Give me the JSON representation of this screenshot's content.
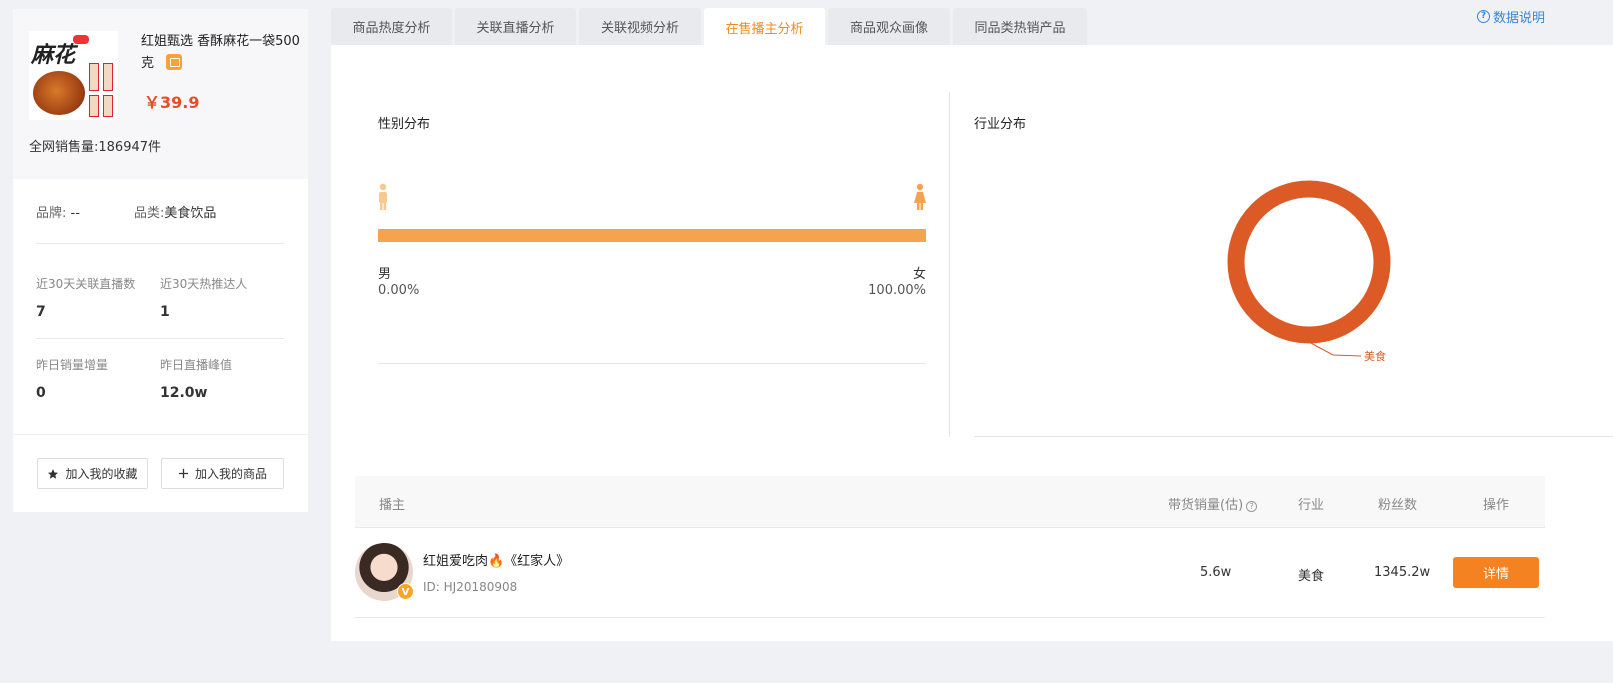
{
  "product": {
    "name": "红姐甄选 香酥麻花一袋500克",
    "image_text": "麻花",
    "price": "￥39.9",
    "sales_label": "全网销售量:",
    "sales_value": "186947件"
  },
  "meta": {
    "brand_label": "品牌:",
    "brand_value": "--",
    "category_label": "品类:",
    "category_value": "美食饮品"
  },
  "stats": [
    {
      "label": "近30天关联直播数",
      "value": "7"
    },
    {
      "label": "近30天热推达人",
      "value": "1"
    },
    {
      "label": "昨日销量增量",
      "value": "0"
    },
    {
      "label": "昨日直播峰值",
      "value": "12.0w"
    }
  ],
  "actions": {
    "add_favorite": "加入我的收藏",
    "add_product": "加入我的商品"
  },
  "tabs": [
    {
      "label": "商品热度分析"
    },
    {
      "label": "关联直播分析"
    },
    {
      "label": "关联视频分析"
    },
    {
      "label": "在售播主分析",
      "active": true
    },
    {
      "label": "商品观众画像"
    },
    {
      "label": "同品类热销产品"
    }
  ],
  "help_link": "数据说明",
  "gender": {
    "title": "性别分布",
    "male_label": "男",
    "male_pct": "0.00%",
    "female_label": "女",
    "female_pct": "100.00%",
    "female_share": 1.0,
    "bar_color": "#f5a34e"
  },
  "industry": {
    "title": "行业分布",
    "chart_data": {
      "type": "pie",
      "slices": [
        {
          "label": "美食",
          "value": 100
        }
      ],
      "colors": [
        "#dc5a26"
      ]
    }
  },
  "table": {
    "headers": [
      "播主",
      "带货销量(估)",
      "行业",
      "粉丝数",
      "操作"
    ],
    "rows": [
      {
        "name": "红姐爱吃肉🔥《红家人》",
        "id": "ID:  HJ20180908",
        "sales": "5.6w",
        "industry": "美食",
        "fans": "1345.2w",
        "action": "详情"
      }
    ]
  },
  "colors": {
    "accent": "#f08a1e",
    "price": "#e94d26",
    "link": "#3a86d6",
    "donut": "#dc5a26",
    "button": "#f58220"
  }
}
